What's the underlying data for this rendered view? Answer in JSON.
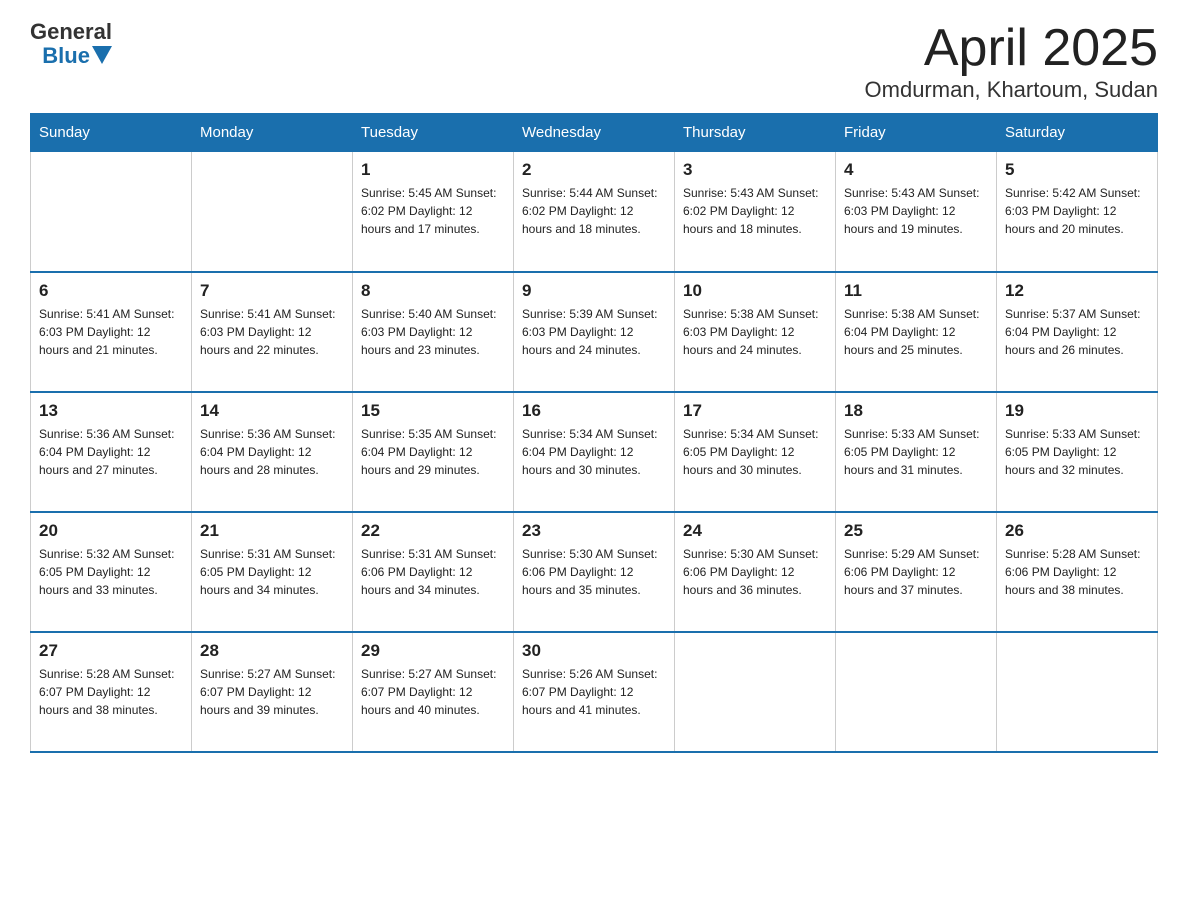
{
  "header": {
    "logo_general": "General",
    "logo_blue": "Blue",
    "title": "April 2025",
    "subtitle": "Omdurman, Khartoum, Sudan"
  },
  "days_of_week": [
    "Sunday",
    "Monday",
    "Tuesday",
    "Wednesday",
    "Thursday",
    "Friday",
    "Saturday"
  ],
  "weeks": [
    [
      {
        "day": "",
        "info": ""
      },
      {
        "day": "",
        "info": ""
      },
      {
        "day": "1",
        "info": "Sunrise: 5:45 AM\nSunset: 6:02 PM\nDaylight: 12 hours\nand 17 minutes."
      },
      {
        "day": "2",
        "info": "Sunrise: 5:44 AM\nSunset: 6:02 PM\nDaylight: 12 hours\nand 18 minutes."
      },
      {
        "day": "3",
        "info": "Sunrise: 5:43 AM\nSunset: 6:02 PM\nDaylight: 12 hours\nand 18 minutes."
      },
      {
        "day": "4",
        "info": "Sunrise: 5:43 AM\nSunset: 6:03 PM\nDaylight: 12 hours\nand 19 minutes."
      },
      {
        "day": "5",
        "info": "Sunrise: 5:42 AM\nSunset: 6:03 PM\nDaylight: 12 hours\nand 20 minutes."
      }
    ],
    [
      {
        "day": "6",
        "info": "Sunrise: 5:41 AM\nSunset: 6:03 PM\nDaylight: 12 hours\nand 21 minutes."
      },
      {
        "day": "7",
        "info": "Sunrise: 5:41 AM\nSunset: 6:03 PM\nDaylight: 12 hours\nand 22 minutes."
      },
      {
        "day": "8",
        "info": "Sunrise: 5:40 AM\nSunset: 6:03 PM\nDaylight: 12 hours\nand 23 minutes."
      },
      {
        "day": "9",
        "info": "Sunrise: 5:39 AM\nSunset: 6:03 PM\nDaylight: 12 hours\nand 24 minutes."
      },
      {
        "day": "10",
        "info": "Sunrise: 5:38 AM\nSunset: 6:03 PM\nDaylight: 12 hours\nand 24 minutes."
      },
      {
        "day": "11",
        "info": "Sunrise: 5:38 AM\nSunset: 6:04 PM\nDaylight: 12 hours\nand 25 minutes."
      },
      {
        "day": "12",
        "info": "Sunrise: 5:37 AM\nSunset: 6:04 PM\nDaylight: 12 hours\nand 26 minutes."
      }
    ],
    [
      {
        "day": "13",
        "info": "Sunrise: 5:36 AM\nSunset: 6:04 PM\nDaylight: 12 hours\nand 27 minutes."
      },
      {
        "day": "14",
        "info": "Sunrise: 5:36 AM\nSunset: 6:04 PM\nDaylight: 12 hours\nand 28 minutes."
      },
      {
        "day": "15",
        "info": "Sunrise: 5:35 AM\nSunset: 6:04 PM\nDaylight: 12 hours\nand 29 minutes."
      },
      {
        "day": "16",
        "info": "Sunrise: 5:34 AM\nSunset: 6:04 PM\nDaylight: 12 hours\nand 30 minutes."
      },
      {
        "day": "17",
        "info": "Sunrise: 5:34 AM\nSunset: 6:05 PM\nDaylight: 12 hours\nand 30 minutes."
      },
      {
        "day": "18",
        "info": "Sunrise: 5:33 AM\nSunset: 6:05 PM\nDaylight: 12 hours\nand 31 minutes."
      },
      {
        "day": "19",
        "info": "Sunrise: 5:33 AM\nSunset: 6:05 PM\nDaylight: 12 hours\nand 32 minutes."
      }
    ],
    [
      {
        "day": "20",
        "info": "Sunrise: 5:32 AM\nSunset: 6:05 PM\nDaylight: 12 hours\nand 33 minutes."
      },
      {
        "day": "21",
        "info": "Sunrise: 5:31 AM\nSunset: 6:05 PM\nDaylight: 12 hours\nand 34 minutes."
      },
      {
        "day": "22",
        "info": "Sunrise: 5:31 AM\nSunset: 6:06 PM\nDaylight: 12 hours\nand 34 minutes."
      },
      {
        "day": "23",
        "info": "Sunrise: 5:30 AM\nSunset: 6:06 PM\nDaylight: 12 hours\nand 35 minutes."
      },
      {
        "day": "24",
        "info": "Sunrise: 5:30 AM\nSunset: 6:06 PM\nDaylight: 12 hours\nand 36 minutes."
      },
      {
        "day": "25",
        "info": "Sunrise: 5:29 AM\nSunset: 6:06 PM\nDaylight: 12 hours\nand 37 minutes."
      },
      {
        "day": "26",
        "info": "Sunrise: 5:28 AM\nSunset: 6:06 PM\nDaylight: 12 hours\nand 38 minutes."
      }
    ],
    [
      {
        "day": "27",
        "info": "Sunrise: 5:28 AM\nSunset: 6:07 PM\nDaylight: 12 hours\nand 38 minutes."
      },
      {
        "day": "28",
        "info": "Sunrise: 5:27 AM\nSunset: 6:07 PM\nDaylight: 12 hours\nand 39 minutes."
      },
      {
        "day": "29",
        "info": "Sunrise: 5:27 AM\nSunset: 6:07 PM\nDaylight: 12 hours\nand 40 minutes."
      },
      {
        "day": "30",
        "info": "Sunrise: 5:26 AM\nSunset: 6:07 PM\nDaylight: 12 hours\nand 41 minutes."
      },
      {
        "day": "",
        "info": ""
      },
      {
        "day": "",
        "info": ""
      },
      {
        "day": "",
        "info": ""
      }
    ]
  ]
}
